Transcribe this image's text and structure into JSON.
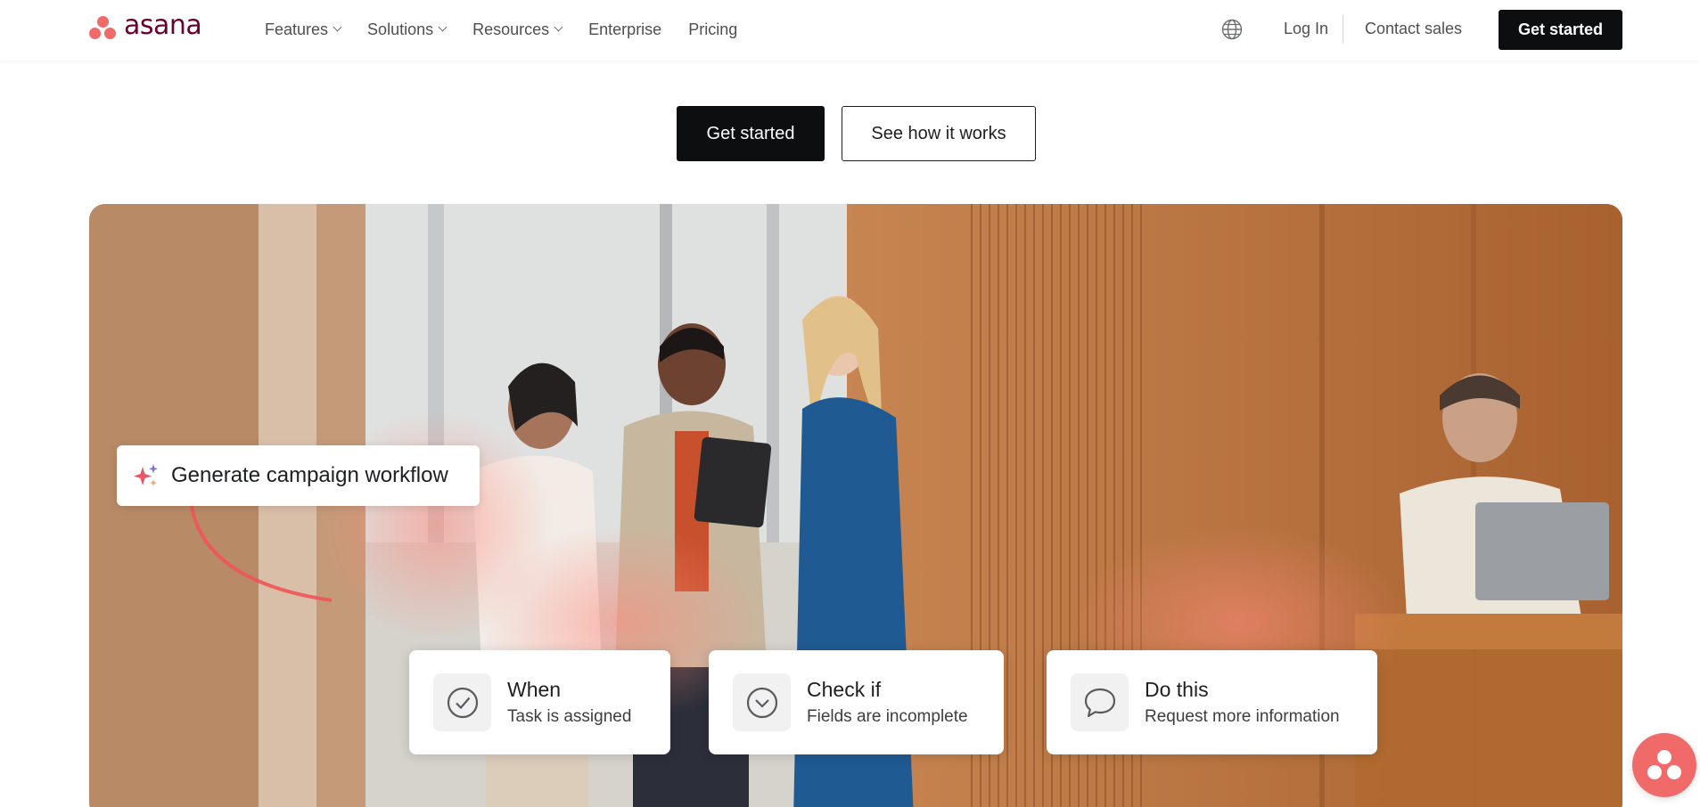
{
  "brand": {
    "name": "asana"
  },
  "nav": {
    "items": [
      {
        "label": "Features",
        "has_dropdown": true
      },
      {
        "label": "Solutions",
        "has_dropdown": true
      },
      {
        "label": "Resources",
        "has_dropdown": true
      },
      {
        "label": "Enterprise",
        "has_dropdown": false
      },
      {
        "label": "Pricing",
        "has_dropdown": false
      }
    ],
    "login_label": "Log In",
    "contact_label": "Contact sales",
    "cta_label": "Get started"
  },
  "hero": {
    "primary_label": "Get started",
    "secondary_label": "See how it works"
  },
  "prompt_card": {
    "text": "Generate campaign workflow",
    "icon": "sparkle-icon"
  },
  "workflow": [
    {
      "title": "When",
      "subtitle": "Task is assigned",
      "icon": "check-circle-icon"
    },
    {
      "title": "Check if",
      "subtitle": "Fields are incomplete",
      "icon": "chevron-circle-icon"
    },
    {
      "title": "Do this",
      "subtitle": "Request more information",
      "icon": "speech-bubble-icon"
    }
  ],
  "colors": {
    "brand": "#f06a6a",
    "logo_text": "#690031",
    "cta": "#0d0e10"
  }
}
